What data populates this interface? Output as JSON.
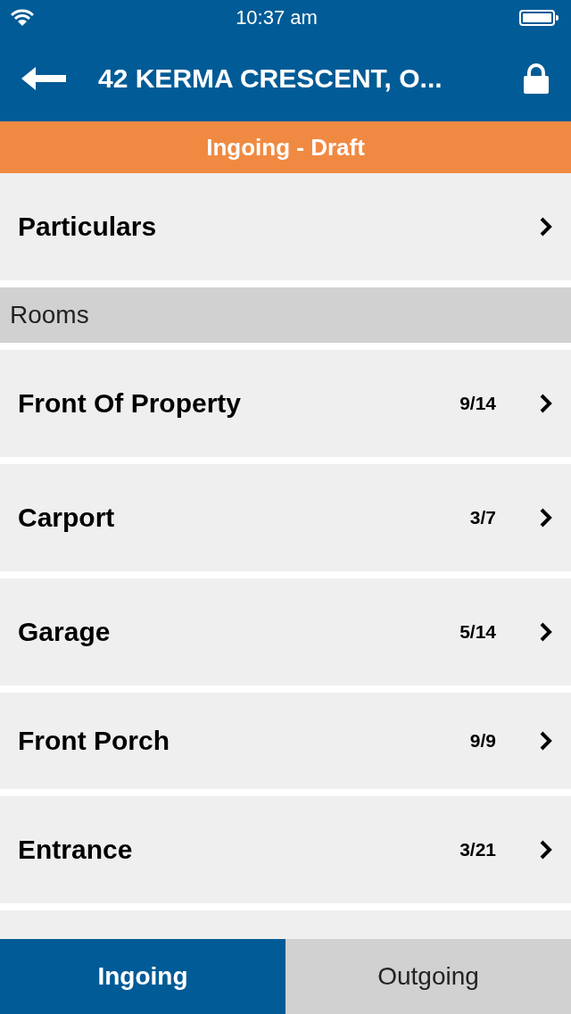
{
  "status_bar": {
    "time": "10:37 am"
  },
  "header": {
    "title": "42 KERMA CRESCENT, O..."
  },
  "banner": {
    "text": "Ingoing - Draft"
  },
  "particulars": {
    "label": "Particulars"
  },
  "section": {
    "title": "Rooms"
  },
  "rooms": [
    {
      "name": "Front Of Property",
      "count": "9/14"
    },
    {
      "name": "Carport",
      "count": "3/7"
    },
    {
      "name": "Garage",
      "count": "5/14"
    },
    {
      "name": "Front Porch",
      "count": "9/9"
    },
    {
      "name": "Entrance",
      "count": "3/21"
    }
  ],
  "tabs": [
    {
      "label": "Ingoing",
      "selected": true
    },
    {
      "label": "Outgoing",
      "selected": false
    }
  ]
}
